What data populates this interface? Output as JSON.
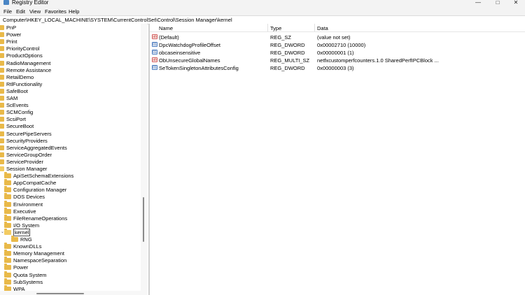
{
  "window": {
    "title": "Registry Editor"
  },
  "menu": [
    "File",
    "Edit",
    "View",
    "Favorites",
    "Help"
  ],
  "address": "Computer\\HKEY_LOCAL_MACHINE\\SYSTEM\\CurrentControlSet\\Control\\Session Manager\\kernel",
  "tree": [
    {
      "label": "PnP"
    },
    {
      "label": "Power"
    },
    {
      "label": "Print"
    },
    {
      "label": "PriorityControl"
    },
    {
      "label": "ProductOptions"
    },
    {
      "label": "RadioManagement"
    },
    {
      "label": "Remote Assistance"
    },
    {
      "label": "RetailDemo"
    },
    {
      "label": "RtlFunctionality"
    },
    {
      "label": "SafeBoot"
    },
    {
      "label": "SAM"
    },
    {
      "label": "ScEvents"
    },
    {
      "label": "SCMConfig"
    },
    {
      "label": "ScsiPort"
    },
    {
      "label": "SecureBoot"
    },
    {
      "label": "SecurePipeServers"
    },
    {
      "label": "SecurityProviders"
    },
    {
      "label": "ServiceAggregatedEvents"
    },
    {
      "label": "ServiceGroupOrder"
    },
    {
      "label": "ServiceProvider"
    },
    {
      "label": "Session Manager"
    },
    {
      "label": "ApiSetSchemaExtensions"
    },
    {
      "label": "AppCompatCache"
    },
    {
      "label": "Configuration Manager"
    },
    {
      "label": "DOS Devices"
    },
    {
      "label": "Environment"
    },
    {
      "label": "Executive"
    },
    {
      "label": "FileRenameOperations"
    },
    {
      "label": "I/O System"
    },
    {
      "label": "kernel"
    },
    {
      "label": "RNG"
    },
    {
      "label": "KnownDLLs"
    },
    {
      "label": "Memory Management"
    },
    {
      "label": "NamespaceSeparation"
    },
    {
      "label": "Power"
    },
    {
      "label": "Quota System"
    },
    {
      "label": "SubSystems"
    },
    {
      "label": "WPA"
    }
  ],
  "columns": {
    "name": "Name",
    "type": "Type",
    "data": "Data"
  },
  "values": [
    {
      "name": "(Default)",
      "type": "REG_SZ",
      "data": "(value not set)",
      "icon": "string-value-icon"
    },
    {
      "name": "DpcWatchdogProfileOffset",
      "type": "REG_DWORD",
      "data": "0x00002710 (10000)",
      "icon": "binary-value-icon"
    },
    {
      "name": "obcaseinsensitive",
      "type": "REG_DWORD",
      "data": "0x00000001 (1)",
      "icon": "binary-value-icon"
    },
    {
      "name": "ObUnsecureGlobalNames",
      "type": "REG_MULTI_SZ",
      "data": "netfxcustomperfcounters.1.0 SharedPerfIPCBlock ...",
      "icon": "string-value-icon"
    },
    {
      "name": "SeTokenSingletonAttributesConfig",
      "type": "REG_DWORD",
      "data": "0x00000003 (3)",
      "icon": "binary-value-icon"
    }
  ],
  "colors": {
    "chrome": "#f3f3f3",
    "folder": "#e9b949",
    "selection_border": "#4d4d4d"
  }
}
